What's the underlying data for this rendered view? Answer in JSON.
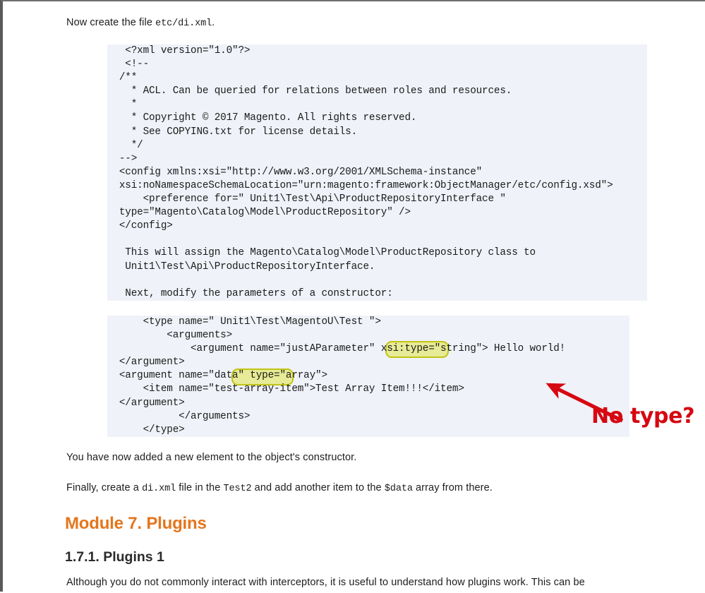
{
  "document": {
    "intro_paragraph": {
      "lead": "Now create the file ",
      "code": "etc/di.xml",
      "tail": "."
    },
    "code_block_1": {
      "name": "di-xml-config-listing",
      "lines": [
        "   <?xml version=\"1.0\"?>",
        "   <!--",
        "  /**",
        "    * ACL. Can be queried for relations between roles and resources.",
        "    *",
        "    * Copyright © 2017 Magento. All rights reserved.",
        "    * See COPYING.txt for license details.",
        "    */",
        "  -->",
        "  <config xmlns:xsi=\"http://www.w3.org/2001/XMLSchema-instance\"",
        "  xsi:noNamespaceSchemaLocation=\"urn:magento:framework:ObjectManager/etc/config.xsd\">",
        "      <preference for=\" Unit1\\Test\\Api\\ProductRepositoryInterface \"",
        "  type=\"Magento\\Catalog\\Model\\ProductRepository\" />",
        "  </config>",
        "",
        "   This will assign the Magento\\Catalog\\Model\\ProductRepository class to",
        "   Unit1\\Test\\Api\\ProductRepositoryInterface.",
        "",
        "   Next, modify the parameters of a constructor:"
      ]
    },
    "code_block_2": {
      "name": "di-xml-arguments-listing",
      "lines": [
        "      <type name=\" Unit1\\Test\\MagentoU\\Test \">",
        "          <arguments>",
        "              <argument name=\"justAParameter\" xsi:type=\"string\"> Hello world!",
        "  </argument>",
        "  <argument name=\"data\" type=\"array\">",
        "      <item name=\"test-array-item\">Test Array Item!!!</item>",
        "  </argument>",
        "            </arguments>",
        "      </type>"
      ]
    },
    "highlights": [
      {
        "name": "highlight-xsi-type",
        "label": "xsi:type=",
        "fill": "#f7f79a",
        "border": "#cfcf15"
      },
      {
        "name": "highlight-type-attr",
        "label": "\" type=\"",
        "fill": "#f7f79a",
        "border": "#cfcf15"
      }
    ],
    "annotation": {
      "name": "no-type-annotation",
      "text": "No type?",
      "color": "#d60812"
    },
    "paragraph_after_code": "You have now added a new element to the object's constructor.",
    "paragraph_finally": {
      "p1": "Finally, create a ",
      "c1": "di.xml",
      "p2": " file in the ",
      "c2": "Test2",
      "p3": " and add another item to the ",
      "c3": "$data",
      "p4": " array from there."
    },
    "module_heading": "Module 7. Plugins",
    "sub_heading": "1.7.1. Plugins 1",
    "final_paragraph": "Although you do not commonly interact with interceptors, it is useful to understand how plugins work. This can be"
  }
}
